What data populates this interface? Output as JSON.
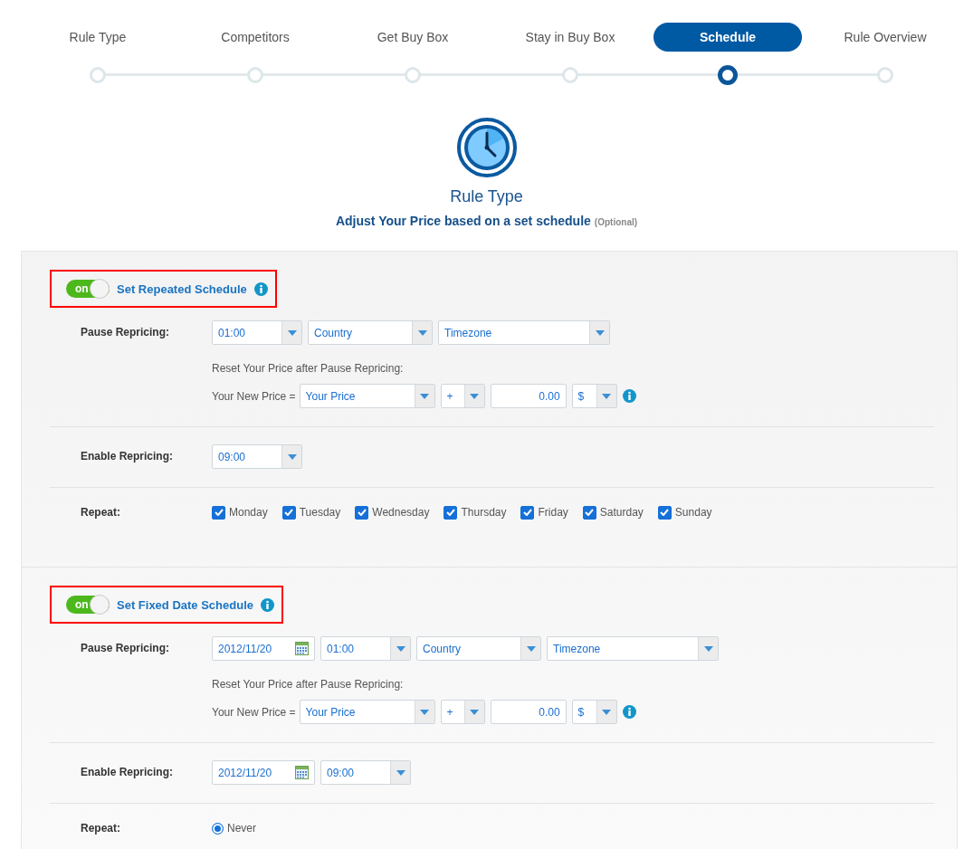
{
  "steps": [
    {
      "label": "Rule Type",
      "selected": false
    },
    {
      "label": "Competitors",
      "selected": false
    },
    {
      "label": "Get Buy Box",
      "selected": false
    },
    {
      "label": "Stay in Buy Box",
      "selected": false
    },
    {
      "label": "Schedule",
      "selected": true
    },
    {
      "label": "Rule Overview",
      "selected": false
    }
  ],
  "header": {
    "title": "Rule Type",
    "subtitle": "Adjust Your Price based on a set schedule",
    "optional": "(Optional)"
  },
  "sections": [
    {
      "title": "Set Repeated Schedule",
      "highlighted": true,
      "toggle": {
        "on": true,
        "text": "on"
      },
      "rows": [
        {
          "kind": "pause",
          "label": "Pause Repricing:",
          "controls": [
            {
              "kind": "time",
              "value": "01:00"
            },
            {
              "kind": "country",
              "value": "Country"
            },
            {
              "kind": "timezone",
              "value": "Timezone"
            }
          ],
          "reset_label": "Reset Your Price after Pause Repricing:",
          "price_prefix": "Your New Price =",
          "price_controls": [
            {
              "kind": "price_base",
              "value": "Your Price"
            },
            {
              "kind": "operator",
              "value": "+"
            },
            {
              "kind": "amount",
              "value": "0.00"
            },
            {
              "kind": "currency",
              "value": "$"
            }
          ]
        },
        {
          "kind": "enable",
          "label": "Enable Repricing:",
          "controls": [
            {
              "kind": "time",
              "value": "09:00"
            }
          ]
        },
        {
          "kind": "checkboxes",
          "label": "Repeat:",
          "options": [
            {
              "label": "Monday",
              "checked": true
            },
            {
              "label": "Tuesday",
              "checked": true
            },
            {
              "label": "Wednesday",
              "checked": true
            },
            {
              "label": "Thursday",
              "checked": true
            },
            {
              "label": "Friday",
              "checked": true
            },
            {
              "label": "Saturday",
              "checked": true
            },
            {
              "label": "Sunday",
              "checked": true
            }
          ]
        }
      ]
    },
    {
      "title": "Set Fixed Date Schedule",
      "highlighted": true,
      "toggle": {
        "on": true,
        "text": "on"
      },
      "rows": [
        {
          "kind": "pause",
          "label": "Pause Repricing:",
          "controls": [
            {
              "kind": "date",
              "value": "2012/11/20"
            },
            {
              "kind": "time",
              "value": "01:00"
            },
            {
              "kind": "country",
              "value": "Country"
            },
            {
              "kind": "timezone",
              "value": "Timezone"
            }
          ],
          "reset_label": "Reset Your Price after Pause Repricing:",
          "price_prefix": "Your New Price =",
          "price_controls": [
            {
              "kind": "price_base",
              "value": "Your Price"
            },
            {
              "kind": "operator",
              "value": "+"
            },
            {
              "kind": "amount",
              "value": "0.00"
            },
            {
              "kind": "currency",
              "value": "$"
            }
          ]
        },
        {
          "kind": "enable",
          "label": "Enable Repricing:",
          "controls": [
            {
              "kind": "date",
              "value": "2012/11/20"
            },
            {
              "kind": "time",
              "value": "09:00"
            }
          ]
        },
        {
          "kind": "radios",
          "label": "Repeat:",
          "options": [
            {
              "label": "Never",
              "selected": true
            }
          ]
        }
      ]
    }
  ]
}
